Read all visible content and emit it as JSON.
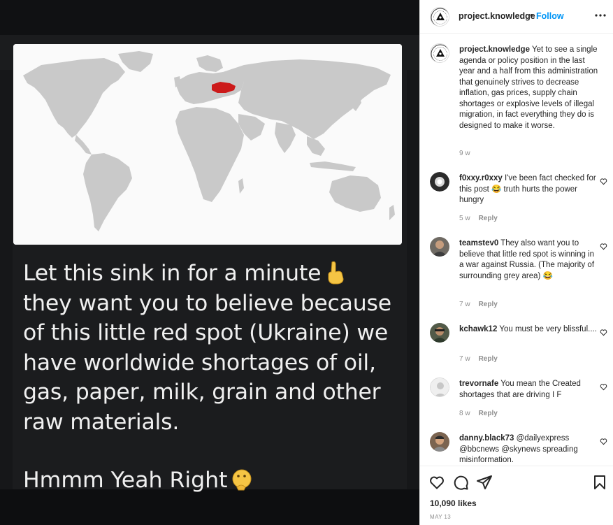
{
  "post": {
    "meme_lines": [
      "Let this sink in for a minute",
      "they want you to believe because of this little red spot (Ukraine) we have worldwide shortages of oil, gas, paper, milk, grain and other raw materials."
    ],
    "meme_sign": "Hmmm Yeah Right",
    "highlight_color": "#cc1a1a"
  },
  "header": {
    "username": "project.knowledge",
    "separator": "•",
    "follow": "Follow",
    "more_icon": "more-horizontal-icon"
  },
  "caption": {
    "username": "project.knowledge",
    "text": "Yet to see a single agenda or policy position in the last year and a half from this administration that genuinely strives to decrease inflation, gas prices, supply chain shortages or explosive levels of illegal migration, in fact everything they do is designed to make it worse.",
    "time": "9 w"
  },
  "comments": [
    {
      "username": "f0xxy.r0xxy",
      "text": "I've been fact checked for this post 😂 truth hurts the power hungry",
      "time": "5 w",
      "reply": "Reply"
    },
    {
      "username": "teamstev0",
      "text": "They also want you to believe that little red spot is winning in a war against Russia. (The majority of surrounding grey area) 😂",
      "time": "7 w",
      "reply": "Reply"
    },
    {
      "username": "kchawk12",
      "text": "You must be very blissful....",
      "time": "7 w",
      "reply": "Reply"
    },
    {
      "username": "trevornafe",
      "text": "You mean the Created shortages that are driving I F",
      "time": "8 w",
      "reply": "Reply"
    },
    {
      "username": "danny.black73",
      "text": "@dailyexpress @bbcnews @skynews spreading misinformation.",
      "time": "",
      "reply": ""
    }
  ],
  "actions": {
    "icons": [
      "heart-icon",
      "comment-icon",
      "share-icon",
      "bookmark-icon"
    ],
    "likes": "10,090 likes",
    "date": "MAY 13"
  }
}
